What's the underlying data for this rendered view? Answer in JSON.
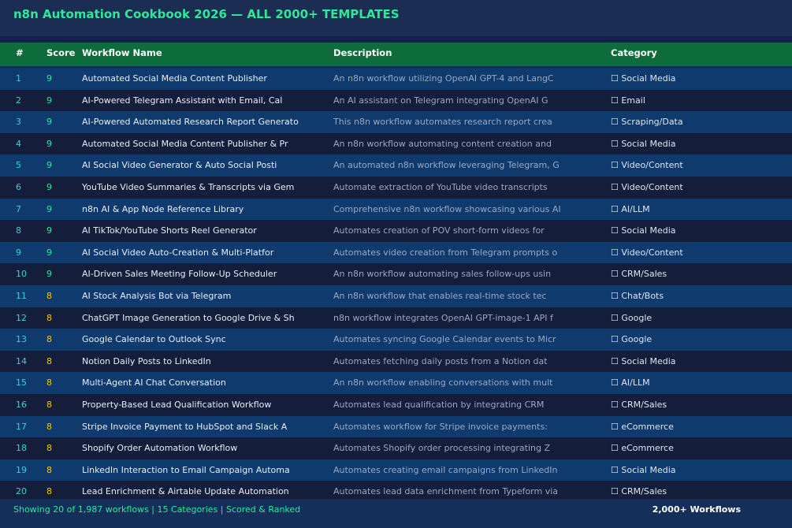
{
  "window": {
    "title": "n8n Automation Cookbook 2026 — ALL 2000+ TEMPLATES"
  },
  "table": {
    "headers": {
      "num": "#",
      "score": "Score",
      "name": "Workflow Name",
      "description": "Description",
      "category": "Category"
    },
    "rows": [
      {
        "num": "1",
        "score": "9",
        "name": "Automated Social Media Content Publisher",
        "description": "An n8n workflow utilizing OpenAI GPT-4 and LangC",
        "category": "☐ Social Media"
      },
      {
        "num": "2",
        "score": "9",
        "name": "AI-Powered Telegram Assistant with Email, Cal",
        "description": "An AI assistant on Telegram integrating OpenAI G",
        "category": "☐ Email"
      },
      {
        "num": "3",
        "score": "9",
        "name": "AI-Powered Automated Research Report Generato",
        "description": "This n8n workflow automates research report crea",
        "category": "☐ Scraping/Data"
      },
      {
        "num": "4",
        "score": "9",
        "name": "Automated Social Media Content Publisher & Pr",
        "description": "An n8n workflow automating content creation and",
        "category": "☐ Social Media"
      },
      {
        "num": "5",
        "score": "9",
        "name": "AI Social Video Generator & Auto Social Posti",
        "description": "An automated n8n workflow leveraging Telegram, G",
        "category": "☐ Video/Content"
      },
      {
        "num": "6",
        "score": "9",
        "name": "YouTube Video Summaries & Transcripts via Gem",
        "description": "Automate extraction of YouTube video transcripts",
        "category": "☐ Video/Content"
      },
      {
        "num": "7",
        "score": "9",
        "name": "n8n AI & App Node Reference Library",
        "description": "Comprehensive n8n workflow showcasing various AI",
        "category": "☐ AI/LLM"
      },
      {
        "num": "8",
        "score": "9",
        "name": "AI TikTok/YouTube Shorts Reel Generator",
        "description": "Automates creation of POV short-form videos for",
        "category": "☐ Social Media"
      },
      {
        "num": "9",
        "score": "9",
        "name": "AI Social Video Auto-Creation & Multi-Platfor",
        "description": "Automates video creation from Telegram prompts o",
        "category": "☐ Video/Content"
      },
      {
        "num": "10",
        "score": "9",
        "name": "AI-Driven Sales Meeting Follow-Up Scheduler",
        "description": "An n8n workflow automating sales follow-ups usin",
        "category": "☐ CRM/Sales"
      },
      {
        "num": "11",
        "score": "8",
        "name": "AI Stock Analysis Bot via Telegram",
        "description": "An n8n workflow that enables real-time stock tec",
        "category": "☐ Chat/Bots"
      },
      {
        "num": "12",
        "score": "8",
        "name": "ChatGPT Image Generation to Google Drive & Sh",
        "description": "n8n workflow integrates OpenAI GPT-image-1 API f",
        "category": "☐ Google"
      },
      {
        "num": "13",
        "score": "8",
        "name": "Google Calendar to Outlook Sync",
        "description": "Automates syncing Google Calendar events to Micr",
        "category": "☐ Google"
      },
      {
        "num": "14",
        "score": "8",
        "name": "Notion Daily Posts to LinkedIn",
        "description": "Automates fetching daily posts from a Notion dat",
        "category": "☐ Social Media"
      },
      {
        "num": "15",
        "score": "8",
        "name": "Multi-Agent AI Chat Conversation",
        "description": "An n8n workflow enabling conversations with mult",
        "category": "☐ AI/LLM"
      },
      {
        "num": "16",
        "score": "8",
        "name": "Property-Based Lead Qualification Workflow",
        "description": "Automates lead qualification by integrating CRM",
        "category": "☐ CRM/Sales"
      },
      {
        "num": "17",
        "score": "8",
        "name": "Stripe Invoice Payment to HubSpot and Slack A",
        "description": "Automates workflow for Stripe invoice payments:",
        "category": "☐ eCommerce"
      },
      {
        "num": "18",
        "score": "8",
        "name": "Shopify Order Automation Workflow",
        "description": "Automates Shopify order processing integrating Z",
        "category": "☐ eCommerce"
      },
      {
        "num": "19",
        "score": "8",
        "name": "LinkedIn Interaction to Email Campaign Automa",
        "description": "Automates creating email campaigns from LinkedIn",
        "category": "☐ Social Media"
      },
      {
        "num": "20",
        "score": "8",
        "name": "Lead Enrichment & Airtable Update Automation",
        "description": "Automates lead data enrichment from Typeform via",
        "category": "☐ CRM/Sales"
      }
    ]
  },
  "footer": {
    "status": "Showing 20 of 1,987 workflows  |  15 Categories  |  Scored & Ranked",
    "count": "2,000+ Workflows"
  },
  "colors": {
    "background": "#1a2a4a",
    "header": "#0e6b3b",
    "accent": "#2ee89a",
    "score_high": "#2ee89a",
    "score_mid": "#f5c518",
    "row_odd": "#0f3a6e",
    "row_even": "#141d3a"
  }
}
